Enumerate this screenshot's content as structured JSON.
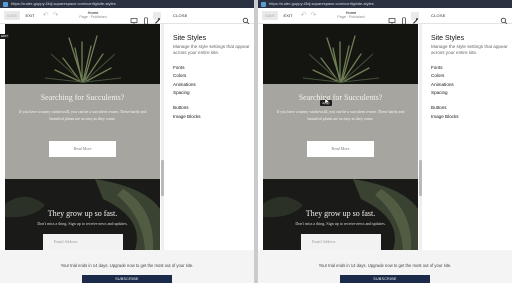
{
  "browser": {
    "left_url": "https://ruder-guppy-t3dj.squarespace.com/config/site-styles",
    "right_url": "https://ruder-guppy-t3dj.squarespace.com/config/site-styles"
  },
  "toolbar": {
    "save_label": "SAVE",
    "exit_label": "EXIT",
    "page_name": "Home",
    "page_status": "Page · Published",
    "close_label": "CLOSE"
  },
  "site_styles": {
    "title": "Site Styles",
    "description": "Manage the style settings that appear across your entire site.",
    "items": [
      {
        "label": "Fonts"
      },
      {
        "label": "Colors"
      },
      {
        "label": "Animations"
      },
      {
        "label": "Spacing"
      },
      {
        "label": "Buttons"
      },
      {
        "label": "Image Blocks"
      }
    ]
  },
  "preview": {
    "heading": "Searching for Succulents?",
    "body": "If you have a sunny windowsill, you can be a succulent owner. These hardy and beautiful plants are as easy as they come.",
    "button_label": "Read More",
    "section2_heading": "They grow up so fast.",
    "section2_sub": "Don't miss a thing. Sign up to receive news and updates.",
    "email_placeholder": "Email Address"
  },
  "trial": {
    "message": "Your trial ends in 14 days. Upgrade now to get the most out of your site.",
    "subscribe_label": "SUBSCRIBE"
  },
  "overlays": {
    "edit_tag": "EDIT",
    "tooltip": "Apply"
  },
  "colors": {
    "browser_bar": "#2a3140",
    "canvas_bg": "#a7a59f",
    "hero_dark": "#161712",
    "subscribe_button": "#1c2a4a"
  }
}
